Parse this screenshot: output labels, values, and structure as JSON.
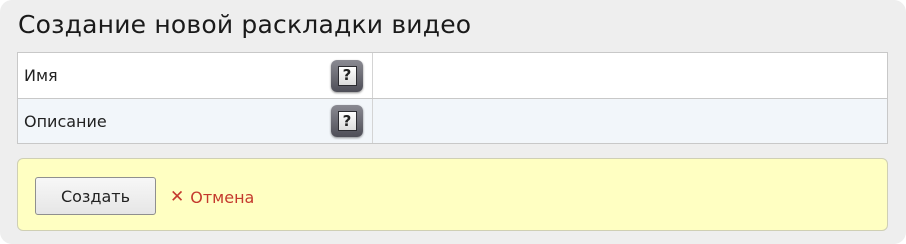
{
  "page": {
    "title": "Создание новой раскладки видео"
  },
  "form": {
    "rows": [
      {
        "label": "Имя",
        "help_icon": "question-mark-icon",
        "value": ""
      },
      {
        "label": "Описание",
        "help_icon": "question-mark-icon",
        "value": ""
      }
    ],
    "help_glyph": "?"
  },
  "actions": {
    "create_label": "Создать",
    "cancel_label": "Отмена",
    "cancel_icon": "close-icon",
    "cancel_glyph": "✕"
  },
  "colors": {
    "panel_bg": "#eeeeee",
    "action_bar_bg": "#ffffc2",
    "cancel_red": "#c43a2e",
    "row_alt_bg": "#f2f6fa"
  }
}
